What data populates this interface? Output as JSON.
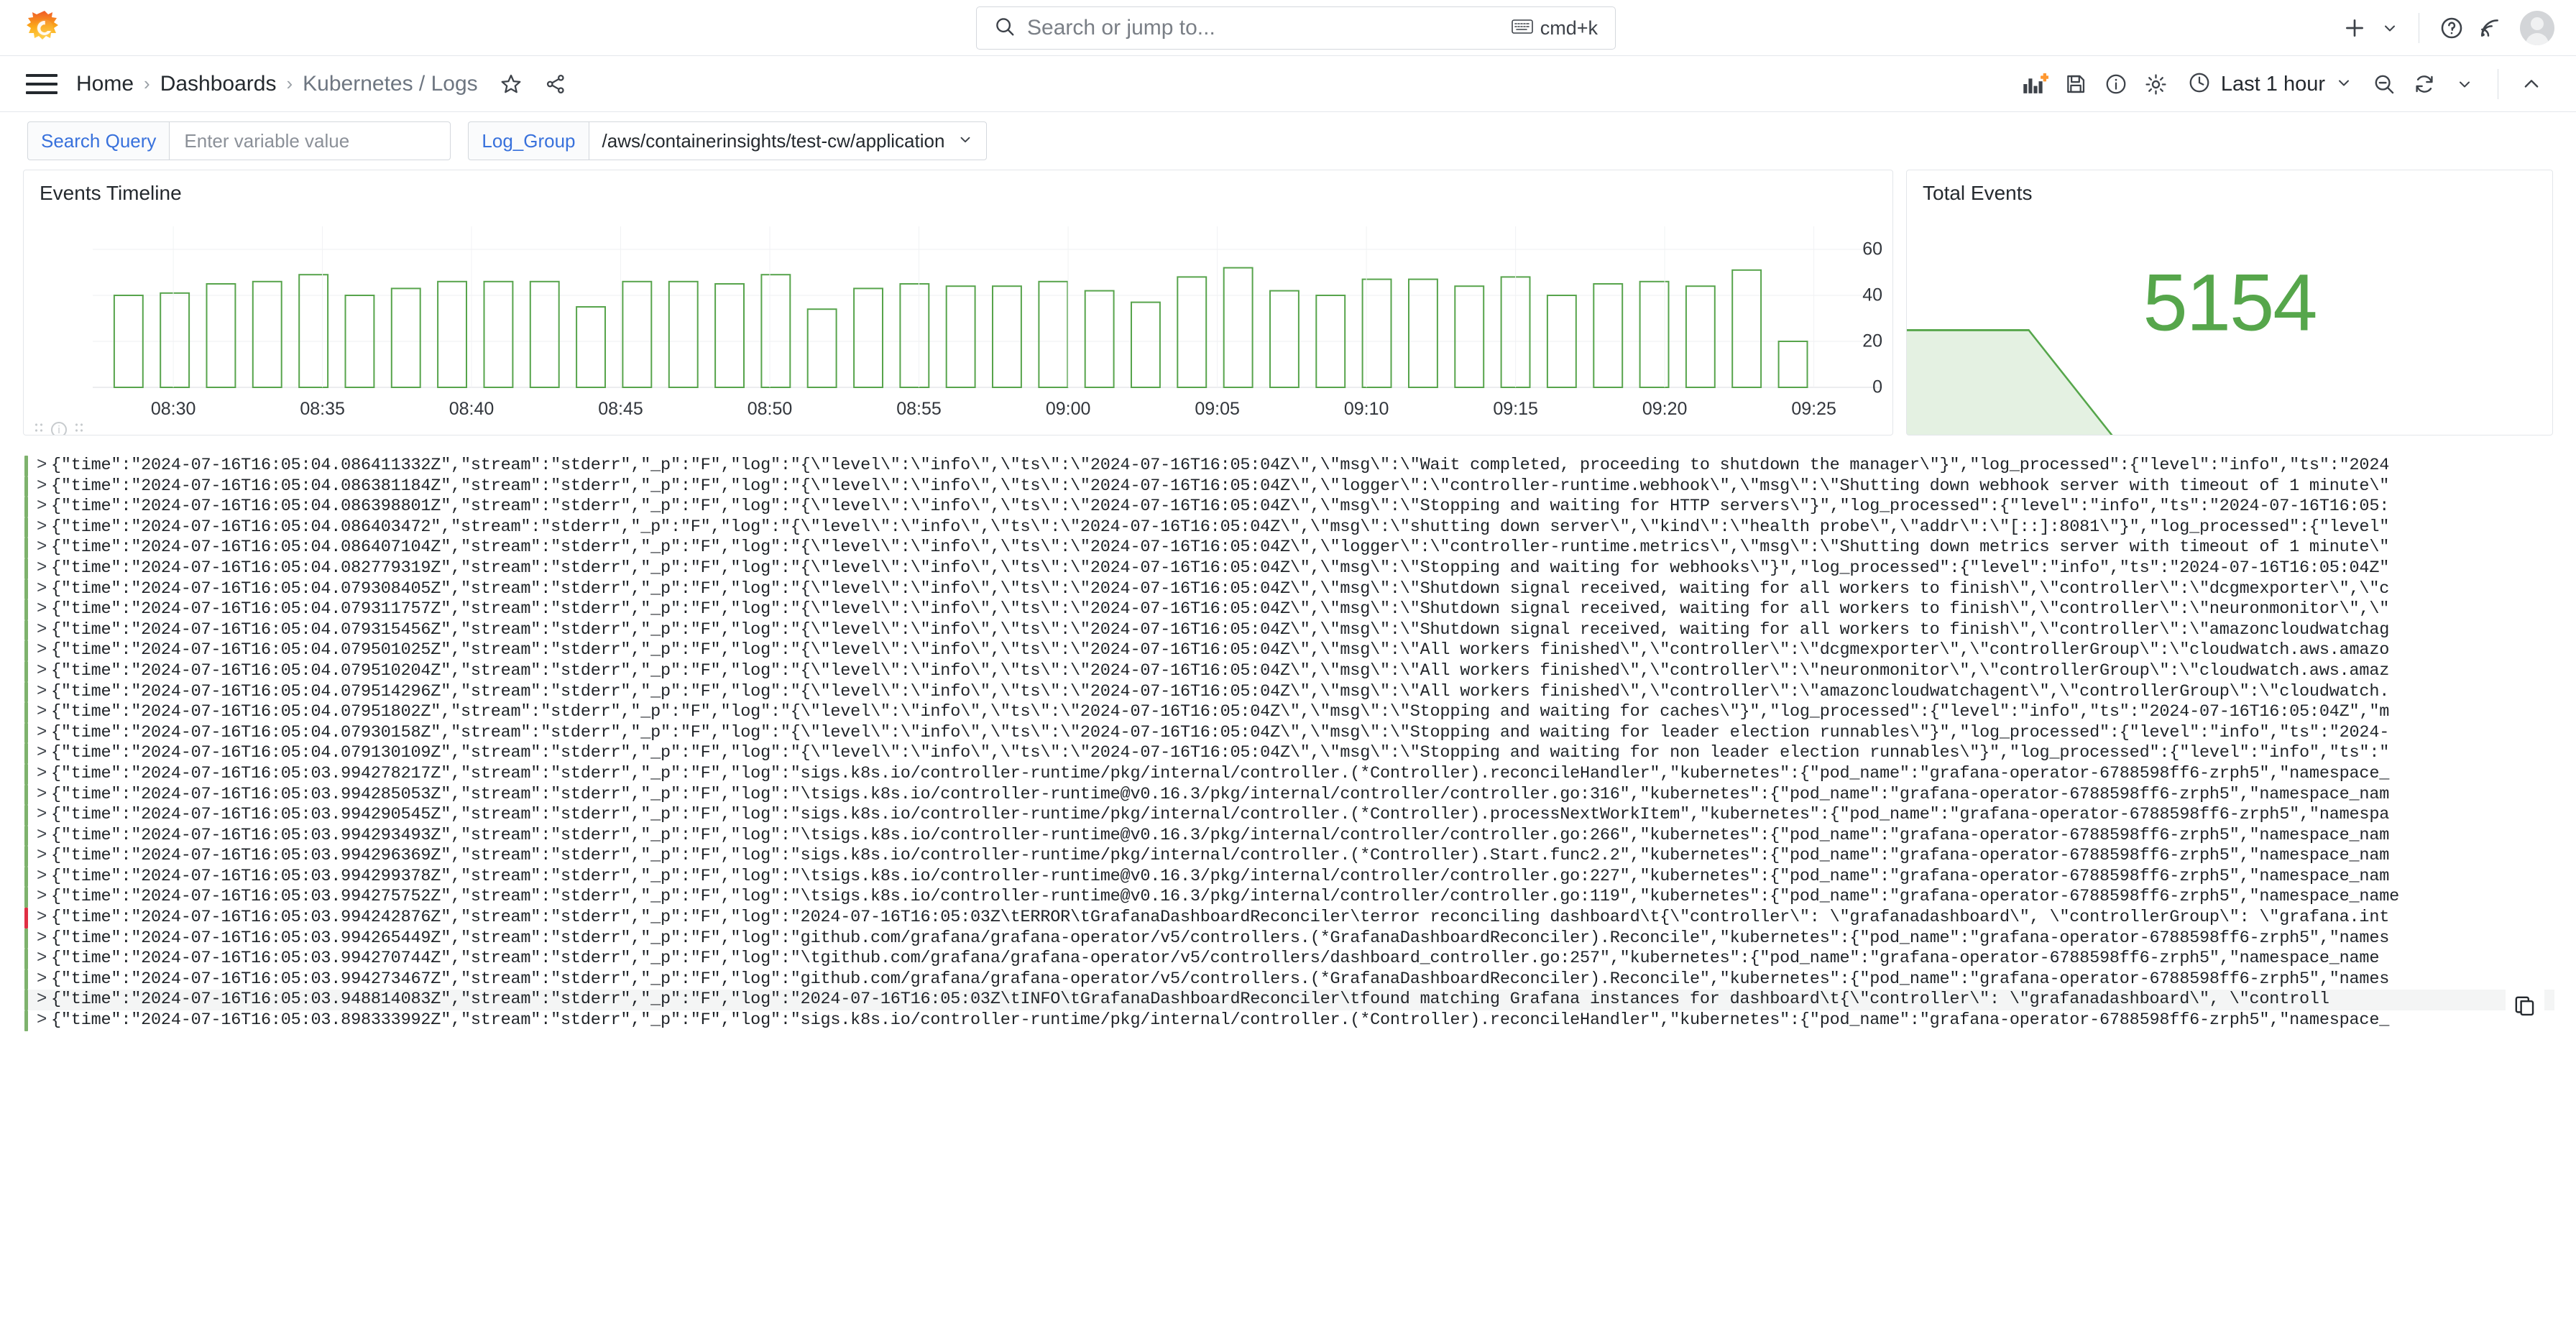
{
  "app": {
    "logo_name": "grafana-logo"
  },
  "search": {
    "placeholder": "Search or jump to...",
    "shortcut": "cmd+k"
  },
  "breadcrumb": {
    "items": [
      {
        "label": "Home"
      },
      {
        "label": "Dashboards"
      },
      {
        "label": "Kubernetes / Logs"
      }
    ],
    "separator": "›"
  },
  "toolbar": {
    "time_range": "Last 1 hour"
  },
  "variables": [
    {
      "label": "Search Query",
      "type": "textbox",
      "value": "",
      "placeholder": "Enter variable value"
    },
    {
      "label": "Log_Group",
      "type": "select",
      "value": "/aws/containerinsights/test-cw/application"
    }
  ],
  "panels": {
    "timeline": {
      "title": "Events Timeline"
    },
    "stat": {
      "title": "Total Events",
      "value": "5154",
      "color": "#56a64b"
    }
  },
  "chart_data": {
    "type": "bar",
    "title": "Events Timeline",
    "xlabel": "",
    "ylabel": "",
    "ylim": [
      0,
      70
    ],
    "yticks": [
      0,
      20,
      40,
      60
    ],
    "grid": true,
    "legend": "none",
    "bar_color": "#57a44c",
    "xtick_labels": [
      "08:30",
      "08:35",
      "08:40",
      "08:45",
      "08:50",
      "08:55",
      "09:00",
      "09:05",
      "09:10",
      "09:15",
      "09:20",
      "09:25"
    ],
    "values": [
      40,
      41,
      45,
      46,
      49,
      40,
      43,
      46,
      46,
      46,
      35,
      46,
      46,
      45,
      49,
      34,
      43,
      45,
      44,
      44,
      46,
      42,
      37,
      48,
      52,
      42,
      40,
      47,
      47,
      44,
      48,
      40,
      45,
      46,
      44,
      51,
      20
    ]
  },
  "logs": {
    "copy_icon": "copy-icon",
    "rows": [
      {
        "level": "info",
        "text": "{\"time\":\"2024-07-16T16:05:04.086411332Z\",\"stream\":\"stderr\",\"_p\":\"F\",\"log\":\"{\\\"level\\\":\\\"info\\\",\\\"ts\\\":\\\"2024-07-16T16:05:04Z\\\",\\\"msg\\\":\\\"Wait completed, proceeding to shutdown the manager\\\"}\",\"log_processed\":{\"level\":\"info\",\"ts\":\"2024"
      },
      {
        "level": "info",
        "text": "{\"time\":\"2024-07-16T16:05:04.086381184Z\",\"stream\":\"stderr\",\"_p\":\"F\",\"log\":\"{\\\"level\\\":\\\"info\\\",\\\"ts\\\":\\\"2024-07-16T16:05:04Z\\\",\\\"logger\\\":\\\"controller-runtime.webhook\\\",\\\"msg\\\":\\\"Shutting down webhook server with timeout of 1 minute\\\""
      },
      {
        "level": "info",
        "text": "{\"time\":\"2024-07-16T16:05:04.086398801Z\",\"stream\":\"stderr\",\"_p\":\"F\",\"log\":\"{\\\"level\\\":\\\"info\\\",\\\"ts\\\":\\\"2024-07-16T16:05:04Z\\\",\\\"msg\\\":\\\"Stopping and waiting for HTTP servers\\\"}\",\"log_processed\":{\"level\":\"info\",\"ts\":\"2024-07-16T16:05:"
      },
      {
        "level": "info",
        "text": "{\"time\":\"2024-07-16T16:05:04.086403472\",\"stream\":\"stderr\",\"_p\":\"F\",\"log\":\"{\\\"level\\\":\\\"info\\\",\\\"ts\\\":\\\"2024-07-16T16:05:04Z\\\",\\\"msg\\\":\\\"shutting down server\\\",\\\"kind\\\":\\\"health probe\\\",\\\"addr\\\":\\\"[::]:8081\\\"}\",\"log_processed\":{\"level\""
      },
      {
        "level": "info",
        "text": "{\"time\":\"2024-07-16T16:05:04.086407104Z\",\"stream\":\"stderr\",\"_p\":\"F\",\"log\":\"{\\\"level\\\":\\\"info\\\",\\\"ts\\\":\\\"2024-07-16T16:05:04Z\\\",\\\"logger\\\":\\\"controller-runtime.metrics\\\",\\\"msg\\\":\\\"Shutting down metrics server with timeout of 1 minute\\\""
      },
      {
        "level": "info",
        "text": "{\"time\":\"2024-07-16T16:05:04.082779319Z\",\"stream\":\"stderr\",\"_p\":\"F\",\"log\":\"{\\\"level\\\":\\\"info\\\",\\\"ts\\\":\\\"2024-07-16T16:05:04Z\\\",\\\"msg\\\":\\\"Stopping and waiting for webhooks\\\"}\",\"log_processed\":{\"level\":\"info\",\"ts\":\"2024-07-16T16:05:04Z\""
      },
      {
        "level": "info",
        "text": "{\"time\":\"2024-07-16T16:05:04.079308405Z\",\"stream\":\"stderr\",\"_p\":\"F\",\"log\":\"{\\\"level\\\":\\\"info\\\",\\\"ts\\\":\\\"2024-07-16T16:05:04Z\\\",\\\"msg\\\":\\\"Shutdown signal received, waiting for all workers to finish\\\",\\\"controller\\\":\\\"dcgmexporter\\\",\\\"c"
      },
      {
        "level": "info",
        "text": "{\"time\":\"2024-07-16T16:05:04.079311757Z\",\"stream\":\"stderr\",\"_p\":\"F\",\"log\":\"{\\\"level\\\":\\\"info\\\",\\\"ts\\\":\\\"2024-07-16T16:05:04Z\\\",\\\"msg\\\":\\\"Shutdown signal received, waiting for all workers to finish\\\",\\\"controller\\\":\\\"neuronmonitor\\\",\\\""
      },
      {
        "level": "info",
        "text": "{\"time\":\"2024-07-16T16:05:04.079315456Z\",\"stream\":\"stderr\",\"_p\":\"F\",\"log\":\"{\\\"level\\\":\\\"info\\\",\\\"ts\\\":\\\"2024-07-16T16:05:04Z\\\",\\\"msg\\\":\\\"Shutdown signal received, waiting for all workers to finish\\\",\\\"controller\\\":\\\"amazoncloudwatchag"
      },
      {
        "level": "info",
        "text": "{\"time\":\"2024-07-16T16:05:04.079501025Z\",\"stream\":\"stderr\",\"_p\":\"F\",\"log\":\"{\\\"level\\\":\\\"info\\\",\\\"ts\\\":\\\"2024-07-16T16:05:04Z\\\",\\\"msg\\\":\\\"All workers finished\\\",\\\"controller\\\":\\\"dcgmexporter\\\",\\\"controllerGroup\\\":\\\"cloudwatch.aws.amazo"
      },
      {
        "level": "info",
        "text": "{\"time\":\"2024-07-16T16:05:04.079510204Z\",\"stream\":\"stderr\",\"_p\":\"F\",\"log\":\"{\\\"level\\\":\\\"info\\\",\\\"ts\\\":\\\"2024-07-16T16:05:04Z\\\",\\\"msg\\\":\\\"All workers finished\\\",\\\"controller\\\":\\\"neuronmonitor\\\",\\\"controllerGroup\\\":\\\"cloudwatch.aws.amaz"
      },
      {
        "level": "info",
        "text": "{\"time\":\"2024-07-16T16:05:04.079514296Z\",\"stream\":\"stderr\",\"_p\":\"F\",\"log\":\"{\\\"level\\\":\\\"info\\\",\\\"ts\\\":\\\"2024-07-16T16:05:04Z\\\",\\\"msg\\\":\\\"All workers finished\\\",\\\"controller\\\":\\\"amazoncloudwatchagent\\\",\\\"controllerGroup\\\":\\\"cloudwatch."
      },
      {
        "level": "info",
        "text": "{\"time\":\"2024-07-16T16:05:04.07951802Z\",\"stream\":\"stderr\",\"_p\":\"F\",\"log\":\"{\\\"level\\\":\\\"info\\\",\\\"ts\\\":\\\"2024-07-16T16:05:04Z\\\",\\\"msg\\\":\\\"Stopping and waiting for caches\\\"}\",\"log_processed\":{\"level\":\"info\",\"ts\":\"2024-07-16T16:05:04Z\",\"m"
      },
      {
        "level": "info",
        "text": "{\"time\":\"2024-07-16T16:05:04.07930158Z\",\"stream\":\"stderr\",\"_p\":\"F\",\"log\":\"{\\\"level\\\":\\\"info\\\",\\\"ts\\\":\\\"2024-07-16T16:05:04Z\\\",\\\"msg\\\":\\\"Stopping and waiting for leader election runnables\\\"}\",\"log_processed\":{\"level\":\"info\",\"ts\":\"2024-"
      },
      {
        "level": "info",
        "text": "{\"time\":\"2024-07-16T16:05:04.079130109Z\",\"stream\":\"stderr\",\"_p\":\"F\",\"log\":\"{\\\"level\\\":\\\"info\\\",\\\"ts\\\":\\\"2024-07-16T16:05:04Z\\\",\\\"msg\\\":\\\"Stopping and waiting for non leader election runnables\\\"}\",\"log_processed\":{\"level\":\"info\",\"ts\":\""
      },
      {
        "level": "info",
        "text": "{\"time\":\"2024-07-16T16:05:03.994278217Z\",\"stream\":\"stderr\",\"_p\":\"F\",\"log\":\"sigs.k8s.io/controller-runtime/pkg/internal/controller.(*Controller).reconcileHandler\",\"kubernetes\":{\"pod_name\":\"grafana-operator-6788598ff6-zrph5\",\"namespace_"
      },
      {
        "level": "info",
        "text": "{\"time\":\"2024-07-16T16:05:03.994285053Z\",\"stream\":\"stderr\",\"_p\":\"F\",\"log\":\"\\tsigs.k8s.io/controller-runtime@v0.16.3/pkg/internal/controller/controller.go:316\",\"kubernetes\":{\"pod_name\":\"grafana-operator-6788598ff6-zrph5\",\"namespace_nam"
      },
      {
        "level": "info",
        "text": "{\"time\":\"2024-07-16T16:05:03.994290545Z\",\"stream\":\"stderr\",\"_p\":\"F\",\"log\":\"sigs.k8s.io/controller-runtime/pkg/internal/controller.(*Controller).processNextWorkItem\",\"kubernetes\":{\"pod_name\":\"grafana-operator-6788598ff6-zrph5\",\"namespa"
      },
      {
        "level": "info",
        "text": "{\"time\":\"2024-07-16T16:05:03.994293493Z\",\"stream\":\"stderr\",\"_p\":\"F\",\"log\":\"\\tsigs.k8s.io/controller-runtime@v0.16.3/pkg/internal/controller/controller.go:266\",\"kubernetes\":{\"pod_name\":\"grafana-operator-6788598ff6-zrph5\",\"namespace_nam"
      },
      {
        "level": "info",
        "text": "{\"time\":\"2024-07-16T16:05:03.994296369Z\",\"stream\":\"stderr\",\"_p\":\"F\",\"log\":\"sigs.k8s.io/controller-runtime/pkg/internal/controller.(*Controller).Start.func2.2\",\"kubernetes\":{\"pod_name\":\"grafana-operator-6788598ff6-zrph5\",\"namespace_nam"
      },
      {
        "level": "info",
        "text": "{\"time\":\"2024-07-16T16:05:03.994299378Z\",\"stream\":\"stderr\",\"_p\":\"F\",\"log\":\"\\tsigs.k8s.io/controller-runtime@v0.16.3/pkg/internal/controller/controller.go:227\",\"kubernetes\":{\"pod_name\":\"grafana-operator-6788598ff6-zrph5\",\"namespace_nam"
      },
      {
        "level": "info",
        "text": "{\"time\":\"2024-07-16T16:05:03.994275752Z\",\"stream\":\"stderr\",\"_p\":\"F\",\"log\":\"\\tsigs.k8s.io/controller-runtime@v0.16.3/pkg/internal/controller/controller.go:119\",\"kubernetes\":{\"pod_name\":\"grafana-operator-6788598ff6-zrph5\",\"namespace_name"
      },
      {
        "level": "error",
        "text": "{\"time\":\"2024-07-16T16:05:03.994242876Z\",\"stream\":\"stderr\",\"_p\":\"F\",\"log\":\"2024-07-16T16:05:03Z\\tERROR\\tGrafanaDashboardReconciler\\terror reconciling dashboard\\t{\\\"controller\\\": \\\"grafanadashboard\\\", \\\"controllerGroup\\\": \\\"grafana.int"
      },
      {
        "level": "info",
        "text": "{\"time\":\"2024-07-16T16:05:03.994265449Z\",\"stream\":\"stderr\",\"_p\":\"F\",\"log\":\"github.com/grafana/grafana-operator/v5/controllers.(*GrafanaDashboardReconciler).Reconcile\",\"kubernetes\":{\"pod_name\":\"grafana-operator-6788598ff6-zrph5\",\"names"
      },
      {
        "level": "info",
        "text": "{\"time\":\"2024-07-16T16:05:03.994270744Z\",\"stream\":\"stderr\",\"_p\":\"F\",\"log\":\"\\tgithub.com/grafana/grafana-operator/v5/controllers/dashboard_controller.go:257\",\"kubernetes\":{\"pod_name\":\"grafana-operator-6788598ff6-zrph5\",\"namespace_name"
      },
      {
        "level": "info",
        "text": "{\"time\":\"2024-07-16T16:05:03.994273467Z\",\"stream\":\"stderr\",\"_p\":\"F\",\"log\":\"github.com/grafana/grafana-operator/v5/controllers.(*GrafanaDashboardReconciler).Reconcile\",\"kubernetes\":{\"pod_name\":\"grafana-operator-6788598ff6-zrph5\",\"names"
      },
      {
        "level": "info",
        "hovered": true,
        "text": "{\"time\":\"2024-07-16T16:05:03.948814083Z\",\"stream\":\"stderr\",\"_p\":\"F\",\"log\":\"2024-07-16T16:05:03Z\\tINFO\\tGrafanaDashboardReconciler\\tfound matching Grafana instances for dashboard\\t{\\\"controller\\\": \\\"grafanadashboard\\\", \\\"controll"
      },
      {
        "level": "info",
        "text": "{\"time\":\"2024-07-16T16:05:03.898333992Z\",\"stream\":\"stderr\",\"_p\":\"F\",\"log\":\"sigs.k8s.io/controller-runtime/pkg/internal/controller.(*Controller).reconcileHandler\",\"kubernetes\":{\"pod_name\":\"grafana-operator-6788598ff6-zrph5\",\"namespace_"
      }
    ]
  }
}
